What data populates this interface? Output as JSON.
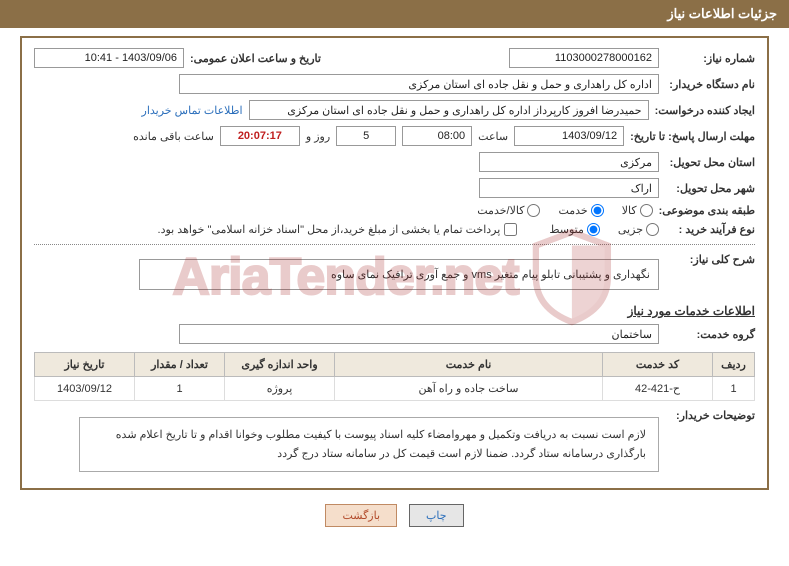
{
  "header": {
    "title": "جزئیات اطلاعات نیاز"
  },
  "fields": {
    "need_no_label": "شماره نیاز:",
    "need_no": "1103000278000162",
    "announce_label": "تاریخ و ساعت اعلان عمومی:",
    "announce_value": "1403/09/06 - 10:41",
    "buyer_org_label": "نام دستگاه خریدار:",
    "buyer_org": "اداره کل راهداری و حمل و نقل جاده ای استان مرکزی",
    "requester_label": "ایجاد کننده درخواست:",
    "requester": "حمیدرضا  افروز  کارپرداز اداره کل راهداری و حمل و نقل جاده ای استان مرکزی",
    "contact_link": "اطلاعات تماس خریدار",
    "deadline_label": "مهلت ارسال پاسخ: تا تاریخ:",
    "deadline_date": "1403/09/12",
    "time_label": "ساعت",
    "deadline_time": "08:00",
    "days_remaining": "5",
    "days_conj": "روز و",
    "countdown": "20:07:17",
    "remaining_suffix": "ساعت باقی مانده",
    "delivery_province_label": "استان محل تحویل:",
    "delivery_province": "مرکزی",
    "delivery_city_label": "شهر محل تحویل:",
    "delivery_city": "اراک",
    "category_label": "طبقه بندی موضوعی:",
    "cat_goods": "کالا",
    "cat_service": "خدمت",
    "cat_goods_service": "کالا/خدمت",
    "process_label": "نوع فرآیند خرید :",
    "proc_minor": "جزیی",
    "proc_medium": "متوسط",
    "payment_note": "پرداخت تمام یا بخشی از مبلغ خرید،از محل \"اسناد خزانه اسلامی\" خواهد بود.",
    "general_desc_label": "شرح کلی نیاز:",
    "general_desc": "نگهداری و پشتیبانی تابلو پیام متغیر vms و جمع آوری ترافیک نمای ساوه",
    "services_info_title": "اطلاعات خدمات مورد نیاز",
    "service_group_label": "گروه خدمت:",
    "service_group": "ساختمان",
    "buyer_notes_label": "توضیحات خریدار:",
    "buyer_notes": "لازم است نسبت به دریافت وتکمیل و مهروامضاء کلیه اسناد پیوست با کیفیت مطلوب وخوانا اقدام و تا تاریخ اعلام شده بارگذاری درسامانه ستاد گردد. ضمنا لازم است قیمت کل در سامانه ستاد درج گردد"
  },
  "table": {
    "headers": {
      "row": "ردیف",
      "code": "کد خدمت",
      "name": "نام خدمت",
      "unit": "واحد اندازه گیری",
      "qty": "تعداد / مقدار",
      "date": "تاریخ نیاز"
    },
    "rows": [
      {
        "row": "1",
        "code": "ح-421-42",
        "name": "ساخت جاده و راه آهن",
        "unit": "پروژه",
        "qty": "1",
        "date": "1403/09/12"
      }
    ]
  },
  "buttons": {
    "print": "چاپ",
    "back": "بازگشت"
  },
  "watermark": "AriaTender.net"
}
